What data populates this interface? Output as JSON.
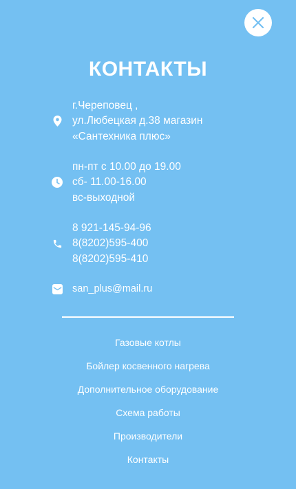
{
  "colors": {
    "background": "#74c0f2",
    "text": "#ffffff",
    "close_button_bg": "#ffffff",
    "close_icon": "#74c0f2"
  },
  "close_button": {
    "icon": "close-icon"
  },
  "title": "КОНТАКТЫ",
  "contacts": {
    "address": {
      "icon": "location-pin-icon",
      "lines": [
        "г.Череповец ,",
        "ул.Любецкая д.38 магазин",
        "«Сантехника плюс»"
      ]
    },
    "hours": {
      "icon": "clock-icon",
      "lines": [
        "пн-пт с 10.00 до 19.00",
        "сб- 11.00-16.00",
        "вс-выходной"
      ]
    },
    "phones": {
      "icon": "phone-icon",
      "lines": [
        "8 921-145-94-96",
        "8(8202)595-400",
        "8(8202)595-410"
      ]
    },
    "email": {
      "icon": "mail-icon",
      "value": "san_plus@mail.ru"
    }
  },
  "nav": {
    "items": [
      "Газовые котлы",
      "Бойлер косвенного нагрева",
      "Дополнительное оборудование",
      "Схема работы",
      "Производители",
      "Контакты"
    ]
  }
}
